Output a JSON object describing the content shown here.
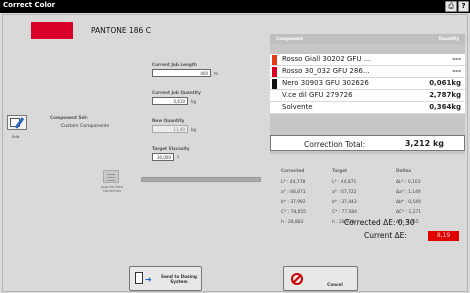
{
  "window": {
    "title": "Correct Color"
  },
  "toolbar": {
    "print_icon": "printer-icon",
    "help_label": "?"
  },
  "color": {
    "swatch_color": "#d9002a",
    "name": "PANTONE 186 C"
  },
  "fields": {
    "current_job_length": {
      "label": "Current Job Length",
      "value": "400",
      "unit": "m"
    },
    "current_job_quantity": {
      "label": "Current Job Quantity",
      "value": "0,610",
      "unit": "kg"
    },
    "new_quantity": {
      "label": "New Quantity",
      "value": "11,40",
      "unit": "kg"
    },
    "target_viscosity": {
      "label": "Target Viscosity",
      "value": "30,000",
      "unit": "s"
    }
  },
  "component_set": {
    "title": "Component Set:",
    "value": "Custom Components",
    "edit_label": "Edit"
  },
  "reapply": {
    "label": "Acquire New Correction"
  },
  "components": {
    "header_component": "Component",
    "header_quantity": "Quantity",
    "items": [
      {
        "name": "Rosso Giall 30202 GFU ...",
        "qty": "---",
        "color": "#e23a12"
      },
      {
        "name": "Rosso 30_032 GFU 286...",
        "qty": "---",
        "color": "#d8001e"
      },
      {
        "name": "Nero 30903 GFU 302626",
        "qty": "0,061kg",
        "color": "#111111"
      },
      {
        "name": "V.ce dil GFU 279726",
        "qty": "2,787kg",
        "color": "#ffffff"
      },
      {
        "name": "Solvente",
        "qty": "0,364kg",
        "color": "#ffffff"
      }
    ],
    "total_label": "Correction Total:",
    "total_value": "3,212 kg"
  },
  "deltas": {
    "head_corrected": "Corrected",
    "head_target": "Target",
    "head_deltas": "Deltas",
    "corrected": [
      "L* : 44,778",
      "a* : 68,871",
      "b* : 37,992",
      "C* : 78,655",
      "h : 28,883"
    ],
    "target": [
      "L* : 44,871",
      "a* : 67,722",
      "b* : 37,443",
      "C* : 77,584",
      "h : 28,938"
    ],
    "delta": [
      "ΔL* : 0,103",
      "Δa* : 1,149",
      "Δb* : 0,549",
      "ΔC* : 1,271",
      "Δh : 0,055"
    ],
    "corrected_de_label": "Corrected ΔE: 0,30",
    "current_de_label": "Current ΔE:",
    "current_de_value": "8,19",
    "current_de_color": "#e00000"
  },
  "buttons": {
    "send_label": "Send to Dosing System",
    "cancel_label": "Cancel"
  }
}
